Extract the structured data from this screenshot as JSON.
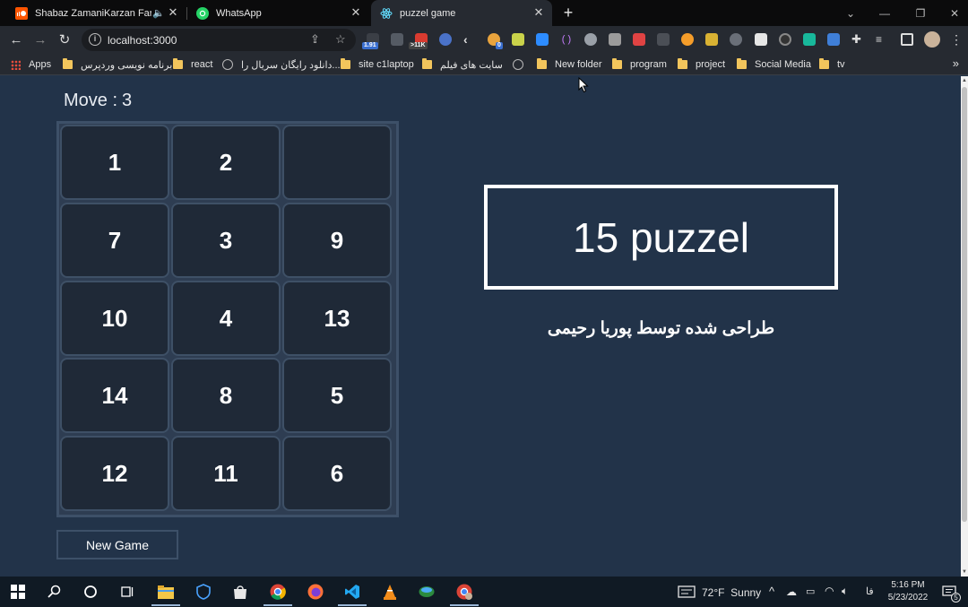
{
  "browser": {
    "tabs": [
      {
        "title": "Shabaz ZamaniKarzan Faruq",
        "favicon": "soundcloud-icon",
        "color": "#ff5500"
      },
      {
        "title": "WhatsApp",
        "favicon": "whatsapp-icon",
        "color": "#25d366"
      },
      {
        "title": "puzzel game",
        "favicon": "react-icon",
        "color": "#61dafb"
      }
    ],
    "address": "localhost:3000",
    "extension_badges": [
      "1.91",
      ">11K",
      "0"
    ],
    "bookmarks": [
      {
        "label": "Apps",
        "icon": "apps-grid-icon"
      },
      {
        "label": "برنامه نویسی وردپرس",
        "icon": "folder-icon"
      },
      {
        "label": "react",
        "icon": "folder-icon"
      },
      {
        "label": "دانلود رایگان سریال را...",
        "icon": "globe-icon"
      },
      {
        "label": "site c1laptop",
        "icon": "folder-icon"
      },
      {
        "label": "سایت های فیلم",
        "icon": "folder-icon"
      },
      {
        "label": "",
        "icon": "globe-icon"
      },
      {
        "label": "New folder",
        "icon": "folder-icon"
      },
      {
        "label": "program",
        "icon": "folder-icon"
      },
      {
        "label": "project",
        "icon": "folder-icon"
      },
      {
        "label": "Social Media",
        "icon": "folder-icon"
      },
      {
        "label": "tv",
        "icon": "folder-icon"
      }
    ]
  },
  "game": {
    "move_label": "Move :",
    "move_count": "3",
    "tiles": [
      "1",
      "2",
      "",
      "7",
      "3",
      "9",
      "10",
      "4",
      "13",
      "14",
      "8",
      "5",
      "12",
      "11",
      "6"
    ],
    "new_game_label": "New Game",
    "title": "15 puzzel",
    "credit": "طراحی شده توسط پوریا رحیمی"
  },
  "taskbar": {
    "weather": "72°F  Sunny",
    "language": "فا",
    "time": "5:16 PM",
    "date": "5/23/2022",
    "notifications": "5"
  },
  "colors": {
    "page_bg": "#223349",
    "tile_bg": "#1f2937",
    "tile_border": "#3e5066",
    "board_border": "#3d5068"
  }
}
